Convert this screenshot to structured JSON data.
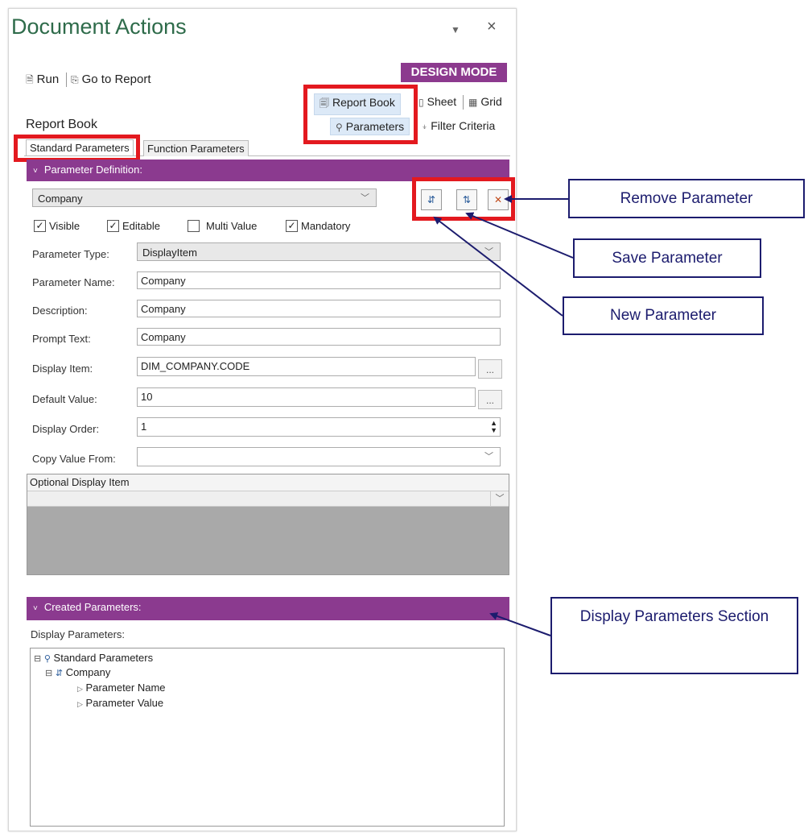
{
  "pane": {
    "title": "Document Actions",
    "pin_icon": "dropdown-caret-icon",
    "close_label": "×"
  },
  "toolbar": {
    "run_label": "Run",
    "go_to_report_label": "Go to Report",
    "design_mode_label": "DESIGN MODE",
    "report_book_label": "Report Book",
    "sheet_label": "Sheet",
    "grid_label": "Grid",
    "parameters_label": "Parameters",
    "filter_criteria_label": "Filter Criteria"
  },
  "page": {
    "section_title": "Report Book",
    "tabs": [
      {
        "label": "Standard Parameters",
        "active": true
      },
      {
        "label": "Function Parameters",
        "active": false
      }
    ]
  },
  "definition": {
    "header": "Parameter Definition:",
    "selected_parameter": "Company",
    "checkboxes": [
      {
        "label": "Visible",
        "checked": true
      },
      {
        "label": "Editable",
        "checked": true
      },
      {
        "label": "Multi Value",
        "checked": false
      },
      {
        "label": "Mandatory",
        "checked": true
      }
    ],
    "fields": {
      "parameter_type_label": "Parameter Type:",
      "parameter_type_value": "DisplayItem",
      "parameter_name_label": "Parameter Name:",
      "parameter_name_value": "Company",
      "description_label": "Description:",
      "description_value": "Company",
      "prompt_text_label": "Prompt Text:",
      "prompt_text_value": "Company",
      "display_item_label": "Display Item:",
      "display_item_value": "DIM_COMPANY.CODE",
      "default_value_label": "Default Value:",
      "default_value_value": "10",
      "display_order_label": "Display Order:",
      "display_order_value": "1",
      "copy_value_from_label": "Copy Value From:",
      "copy_value_from_value": ""
    },
    "ellipsis_label": "...",
    "optional_display_item_header": "Optional Display Item"
  },
  "created": {
    "header": "Created Parameters:",
    "display_parameters_label": "Display Parameters:",
    "tree": {
      "root": "Standard Parameters",
      "child": "Company",
      "leaves": [
        "Parameter Name",
        "Parameter Value"
      ]
    }
  },
  "callouts": {
    "remove_parameter": "Remove Parameter",
    "save_parameter": "Save Parameter",
    "new_parameter": "New Parameter",
    "display_parameters_section": "Display Parameters Section"
  },
  "colors": {
    "accent_purple": "#8b3a8f",
    "callout_navy": "#1c1c6e",
    "highlight_red": "#e3191f",
    "title_green": "#2e6b4a"
  }
}
